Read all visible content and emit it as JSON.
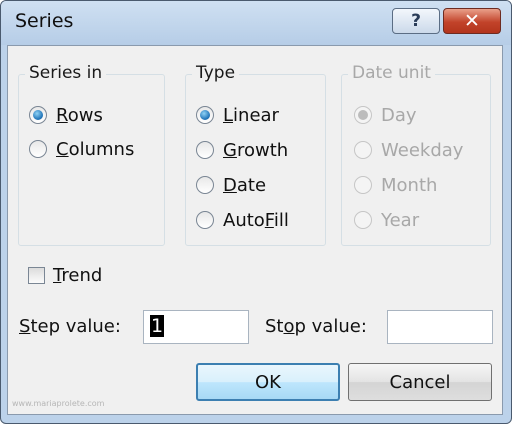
{
  "window": {
    "title": "Series",
    "help_glyph": "?",
    "close_glyph": "✕"
  },
  "series_in": {
    "title": "Series in",
    "options": [
      {
        "pre": "",
        "key": "R",
        "post": "ows",
        "checked": true
      },
      {
        "pre": "",
        "key": "C",
        "post": "olumns",
        "checked": false
      }
    ]
  },
  "type": {
    "title": "Type",
    "options": [
      {
        "pre": "",
        "key": "L",
        "post": "inear",
        "checked": true
      },
      {
        "pre": "",
        "key": "G",
        "post": "rowth",
        "checked": false
      },
      {
        "pre": "",
        "key": "D",
        "post": "ate",
        "checked": false
      },
      {
        "pre": "Auto",
        "key": "F",
        "post": "ill",
        "checked": false
      }
    ]
  },
  "date_unit": {
    "title": "Date unit",
    "disabled": true,
    "options": [
      {
        "label": "Day",
        "checked": true
      },
      {
        "label": "Weekday",
        "checked": false
      },
      {
        "label": "Month",
        "checked": false
      },
      {
        "label": "Year",
        "checked": false
      }
    ]
  },
  "trend": {
    "pre": "",
    "key": "T",
    "post": "rend",
    "checked": false
  },
  "step": {
    "pre": "",
    "key": "S",
    "post": "tep value:",
    "value": "1"
  },
  "stop": {
    "pre": "St",
    "key": "o",
    "post": "p value:",
    "value": ""
  },
  "buttons": {
    "ok": "OK",
    "cancel": "Cancel"
  },
  "watermark": "www.mariaprolete.com",
  "colors": {
    "title_bar": "#bcd2ea",
    "close_button": "#c2432a",
    "radio_selected": "#1a6fb5",
    "disabled_text": "#a8a8a8"
  }
}
